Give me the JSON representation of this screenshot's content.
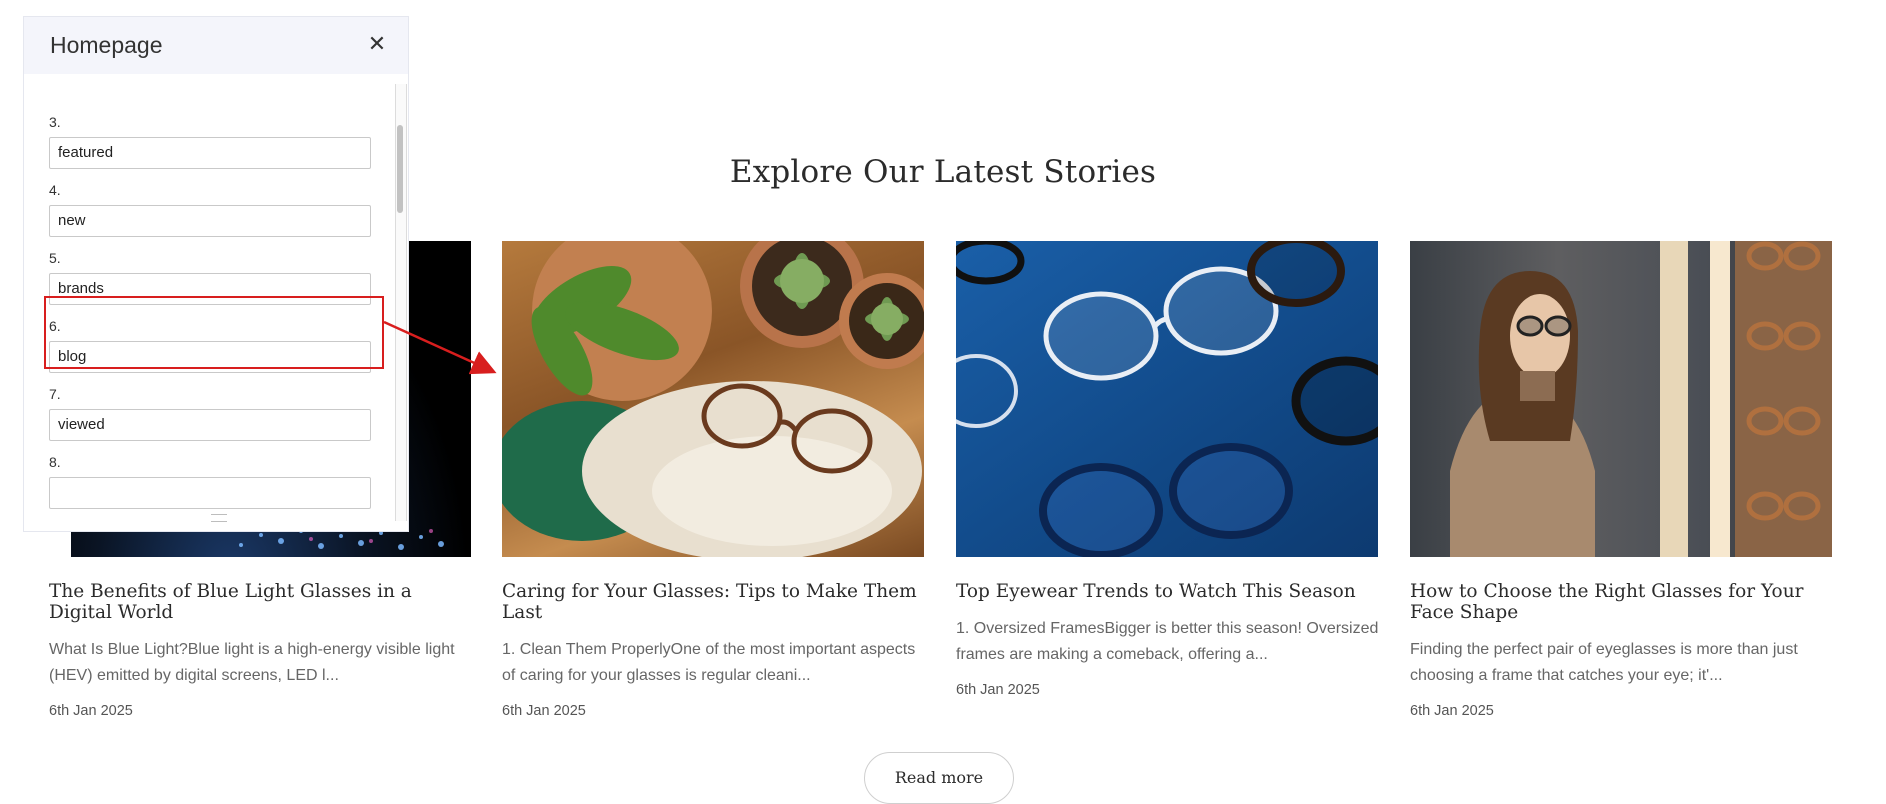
{
  "section": {
    "title": "Explore Our Latest Stories"
  },
  "cards": [
    {
      "image_icon": "blue-light-image",
      "title": "The Benefits of Blue Light Glasses in a Digital World",
      "excerpt": "What Is Blue Light?Blue light is a high-energy visible light (HEV) emitted by digital screens, LED l...",
      "date": "6th Jan 2025"
    },
    {
      "image_icon": "plants-glasses-image",
      "title": "Caring for Your Glasses: Tips to Make Them Last",
      "excerpt": "1. Clean Them ProperlyOne of the most important aspects of caring for your glasses is regular cleani...",
      "date": "6th Jan 2025"
    },
    {
      "image_icon": "eyewear-trends-image",
      "title": "Top Eyewear Trends to Watch This Season",
      "excerpt": "1. Oversized FramesBigger is better this season! Oversized frames are making a comeback, offering a...",
      "date": "6th Jan 2025"
    },
    {
      "image_icon": "woman-choosing-glasses-image",
      "title": "How to Choose the Right Glasses for Your Face Shape",
      "excerpt": "Finding the perfect pair of eyeglasses is more than just choosing a frame that catches your eye; it'...",
      "date": "6th Jan 2025"
    }
  ],
  "read_more": {
    "label": "Read more"
  },
  "panel": {
    "title": "Homepage",
    "close_glyph": "✕",
    "fields": [
      {
        "label": "3.",
        "value": "featured"
      },
      {
        "label": "4.",
        "value": "new"
      },
      {
        "label": "5.",
        "value": "brands"
      },
      {
        "label": "6.",
        "value": "blog"
      },
      {
        "label": "7.",
        "value": "viewed"
      },
      {
        "label": "8.",
        "value": ""
      }
    ]
  },
  "annotation": {
    "color": "#d81e1e",
    "highlighted_field": "6."
  },
  "colors": {
    "panel_header_bg": "#f4f5fb",
    "title_text": "#2b2b2b",
    "excerpt_text": "#666666"
  }
}
